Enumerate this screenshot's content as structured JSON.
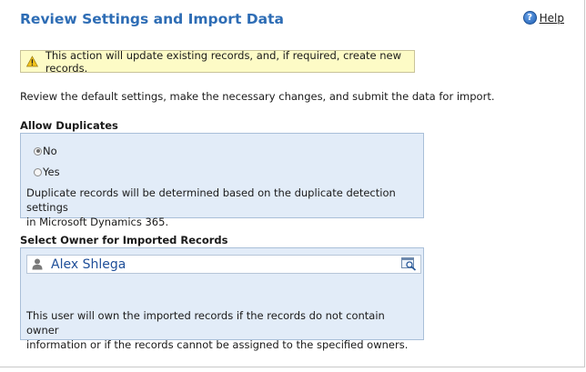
{
  "header": {
    "title": "Review Settings and Import Data",
    "help_label": "Help",
    "help_icon": "help-icon"
  },
  "warning": {
    "icon": "warning-icon",
    "text": "This action will update existing records, and, if required, create new records."
  },
  "intro_text": "Review the default settings, make the necessary changes, and submit the data for import.",
  "duplicates": {
    "label": "Allow Duplicates",
    "options": [
      {
        "label": "No",
        "selected": true
      },
      {
        "label": "Yes",
        "selected": false
      }
    ],
    "note_line1": "Duplicate records will be determined based on the duplicate detection settings",
    "note_line2": "in Microsoft Dynamics 365."
  },
  "owner": {
    "label": "Select Owner for Imported Records",
    "value": "Alex Shlega",
    "value_icon": "user-icon",
    "lookup_icon": "lookup-icon",
    "note_line1": "This user will own the imported records if the records do not contain owner",
    "note_line2": "information or if the records cannot be assigned to the specified owners."
  },
  "colors": {
    "title": "#2e6db5",
    "warning_bg": "#fdfbc6",
    "panel_bg": "#e2ecf8",
    "lookup_text": "#1f4f99"
  }
}
